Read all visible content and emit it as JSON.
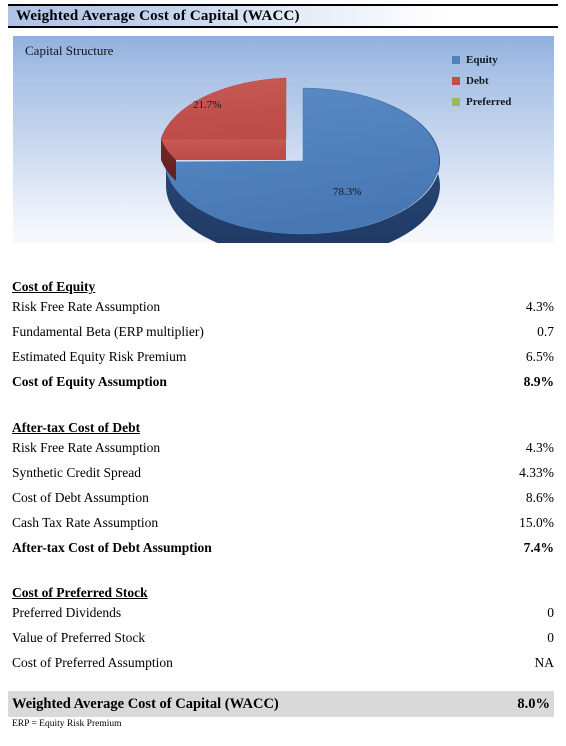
{
  "header": {
    "title": "Weighted Average Cost of Capital (WACC)"
  },
  "chart_data": {
    "type": "pie",
    "title": "Capital Structure",
    "categories": [
      "Equity",
      "Debt",
      "Preferred"
    ],
    "values": [
      78.3,
      21.7,
      0
    ],
    "data_labels": [
      "78.3%",
      "21.7%",
      ""
    ],
    "colors": [
      "#4f81bd",
      "#c0504d",
      "#9bbb59"
    ],
    "legend_position": "right",
    "exploded": [
      "Debt"
    ],
    "three_d": true,
    "grid": false,
    "xlabel": "",
    "ylabel": ""
  },
  "legend": [
    {
      "label": "Equity",
      "color": "#4f81bd"
    },
    {
      "label": "Debt",
      "color": "#c0504d"
    },
    {
      "label": "Preferred",
      "color": "#9bbb59"
    }
  ],
  "sections": [
    {
      "heading": "Cost of Equity",
      "rows": [
        {
          "label": "Risk Free Rate Assumption",
          "value": "4.3%"
        },
        {
          "label": "Fundamental Beta (ERP multiplier)",
          "value": "0.7"
        },
        {
          "label": "Estimated Equity Risk Premium",
          "value": "6.5%"
        },
        {
          "label": "Cost of Equity Assumption",
          "value": "8.9%"
        }
      ]
    },
    {
      "heading": "After-tax Cost of Debt",
      "rows": [
        {
          "label": "Risk Free Rate Assumption",
          "value": "4.3%"
        },
        {
          "label": "Synthetic Credit Spread",
          "value": "4.33%"
        },
        {
          "label": "Cost of Debt Assumption",
          "value": "8.6%"
        },
        {
          "label": "Cash Tax Rate Assumption",
          "value": "15.0%"
        },
        {
          "label": "After-tax Cost of Debt Assumption",
          "value": "7.4%"
        }
      ]
    },
    {
      "heading": "Cost of Preferred Stock",
      "rows": [
        {
          "label": "Preferred Dividends",
          "value": "0"
        },
        {
          "label": "Value of Preferred Stock",
          "value": "0"
        },
        {
          "label": "Cost of Preferred Assumption",
          "value": "NA"
        }
      ]
    }
  ],
  "footer": {
    "wacc_label": "Weighted Average Cost of Capital (WACC)",
    "wacc_value": "8.0%",
    "footnote": "ERP = Equity Risk Premium"
  }
}
